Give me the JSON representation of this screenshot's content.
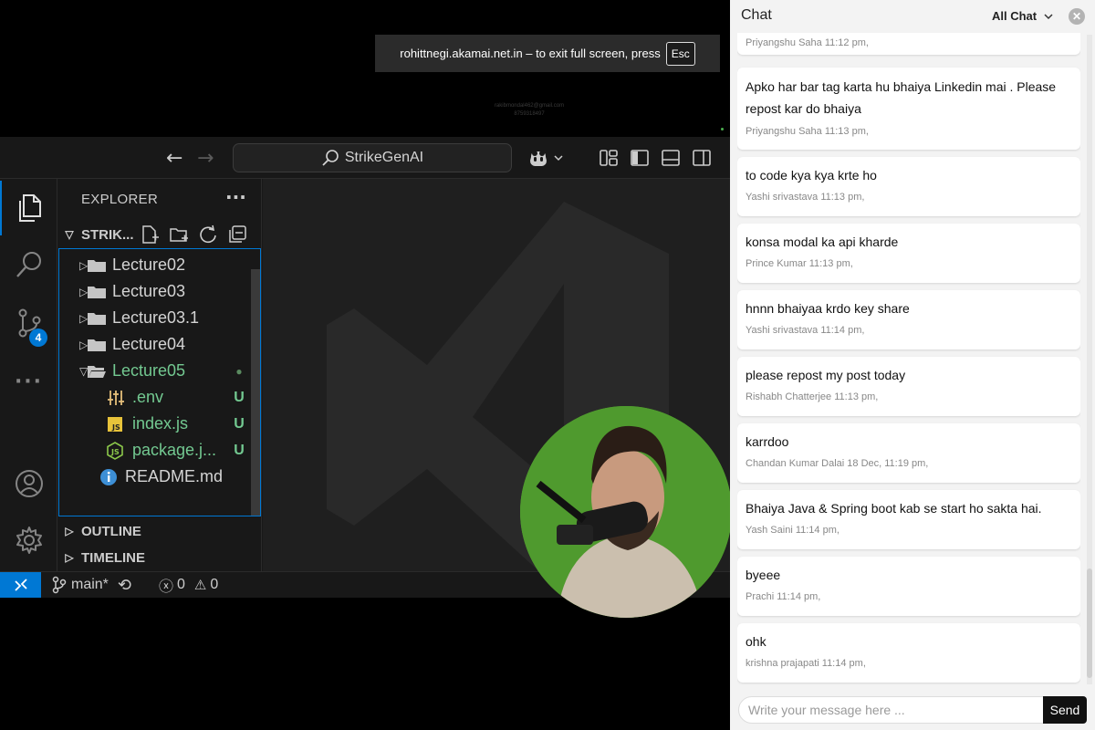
{
  "fullscreen_notice": {
    "text": "rohittnegi.akamai.net.in – to exit full screen, press",
    "key": "Esc"
  },
  "watermark": {
    "line1": "rakibmondal462@gmail.com",
    "line2": "8759318497"
  },
  "vscode": {
    "search_label": "StrikeGenAI",
    "explorer_title": "EXPLORER",
    "project_name": "STRIK...",
    "scm_badge": "4",
    "tree": [
      {
        "label": "Lecture02",
        "type": "folder",
        "status": ""
      },
      {
        "label": "Lecture03",
        "type": "folder",
        "status": ""
      },
      {
        "label": "Lecture03.1",
        "type": "folder",
        "status": ""
      },
      {
        "label": "Lecture04",
        "type": "folder",
        "status": ""
      },
      {
        "label": "Lecture05",
        "type": "folder-open",
        "status": "●"
      },
      {
        "label": ".env",
        "type": "env-file",
        "status": "U"
      },
      {
        "label": "index.js",
        "type": "js-file",
        "status": "U"
      },
      {
        "label": "package.j...",
        "type": "json-file",
        "status": "U"
      },
      {
        "label": "README.md",
        "type": "info-file",
        "status": ""
      }
    ],
    "outline_label": "OUTLINE",
    "timeline_label": "TIMELINE",
    "status": {
      "branch": "main*",
      "errors": "0",
      "warnings": "0"
    },
    "colors": {
      "accent": "#0078d4",
      "untracked": "#73c991",
      "background": "#181818"
    }
  },
  "chat": {
    "title": "Chat",
    "filter": "All Chat",
    "messages": [
      {
        "text": "",
        "meta": "Priyangshu Saha 11:12 pm,"
      },
      {
        "text": "Apko har bar tag karta hu bhaiya Linkedin mai . Please repost kar do bhaiya",
        "meta": "Priyangshu Saha 11:13 pm,"
      },
      {
        "text": "to code kya kya krte ho",
        "meta": "Yashi srivastava 11:13 pm,"
      },
      {
        "text": "konsa modal ka api kharde",
        "meta": "Prince Kumar 11:13 pm,"
      },
      {
        "text": "hnnn bhaiyaa krdo key share",
        "meta": "Yashi srivastava 11:14 pm,"
      },
      {
        "text": "please repost my post today",
        "meta": "Rishabh Chatterjee 11:13 pm,"
      },
      {
        "text": "karrdoo",
        "meta": "Chandan Kumar Dalai 18 Dec, 11:19 pm,"
      },
      {
        "text": "Bhaiya Java & Spring boot kab se start ho sakta hai.",
        "meta": "Yash Saini 11:14 pm,"
      },
      {
        "text": "byeee",
        "meta": "Prachi 11:14 pm,"
      },
      {
        "text": "ohk",
        "meta": "krishna prajapati 11:14 pm,"
      }
    ],
    "input_placeholder": "Write your message here ...",
    "send_label": "Send"
  }
}
